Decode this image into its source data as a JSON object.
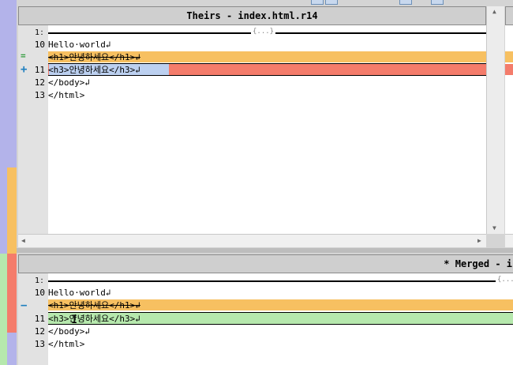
{
  "theme": {
    "theirs_color": "#b3b3ea",
    "orange_color": "#f7c061",
    "red_color": "#f47c6b",
    "green_color": "#b6e8ad",
    "blue_color": "#b3b3ea"
  },
  "toolbar": {
    "icons": [
      "toolbar-button-1",
      "toolbar-button-2",
      "toolbar-button-3",
      "toolbar-button-4"
    ]
  },
  "theirs": {
    "title": "Theirs - index.html.r14",
    "folded_label": "{...}",
    "fold_marker": "1ː",
    "lines": [
      {
        "num": "10",
        "text": "Hello·world↲",
        "style": "plain"
      },
      {
        "num": "",
        "text": "<h1>안녕하세요</h1>↲",
        "style": "orange"
      },
      {
        "num": "11",
        "text": "<h3>안녕하세요</h3>↲",
        "style": "red"
      },
      {
        "num": "12",
        "text": "</body>↲",
        "style": "plain"
      },
      {
        "num": "13",
        "text": "</html>",
        "style": "plain"
      }
    ],
    "markers": [
      "equal-icon",
      "plus-icon"
    ]
  },
  "merged": {
    "title": "* Merged - i",
    "folded_label": "{...",
    "fold_marker": "1ː",
    "lines": [
      {
        "num": "10",
        "text": "Hello·world↲",
        "style": "plain"
      },
      {
        "num": "",
        "text": "<h1>안녕하세요</h1>↲",
        "style": "orange"
      },
      {
        "num": "11",
        "text": "<h3>안녕하세요</h3>↲",
        "style": "green"
      },
      {
        "num": "12",
        "text": "</body>↲",
        "style": "plain"
      },
      {
        "num": "13",
        "text": "</html>",
        "style": "plain"
      }
    ],
    "markers": [
      "minus-icon"
    ]
  }
}
